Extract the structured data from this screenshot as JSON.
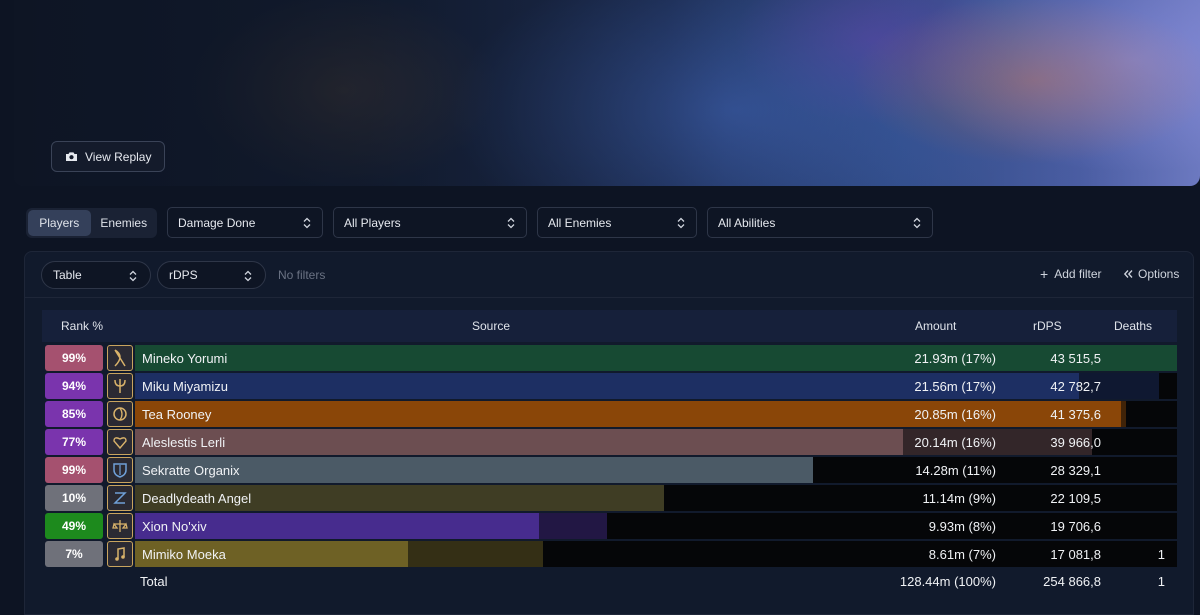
{
  "banner": {
    "replay_label": "View Replay"
  },
  "controls": {
    "segment": [
      "Players",
      "Enemies"
    ],
    "metric": "Damage Done",
    "players": "All Players",
    "enemies": "All Enemies",
    "abilities": "All Abilities"
  },
  "panel": {
    "view": "Table",
    "stat": "rDPS",
    "no_filters": "No filters",
    "add_filter": "Add filter",
    "options": "Options"
  },
  "table": {
    "headers": {
      "rank": "Rank %",
      "source": "Source",
      "amount": "Amount",
      "rdps": "rDPS",
      "deaths": "Deaths"
    },
    "rows": [
      {
        "rank": "99%",
        "rank_color": "#a5516f",
        "spec_icon": "bow-icon",
        "name": "Mineko Yorumi",
        "amount": "21.93m (17%)",
        "rdps": "43 515,5",
        "deaths": "",
        "bar_color": "#174a33",
        "amount_fraction": 1.0,
        "rdps_fraction": 1.0
      },
      {
        "rank": "94%",
        "rank_color": "#7a34ad",
        "spec_icon": "trident-icon",
        "name": "Miku Miyamizu",
        "amount": "21.56m (17%)",
        "rdps": "42 782,7",
        "deaths": "",
        "bar_color": "#1d2f63",
        "amount_fraction": 0.906,
        "rdps_fraction": 0.983
      },
      {
        "rank": "85%",
        "rank_color": "#7a34ad",
        "spec_icon": "spiral-icon",
        "name": "Tea Rooney",
        "amount": "20.85m (16%)",
        "rdps": "41 375,6",
        "deaths": "",
        "bar_color": "#8a4608",
        "amount_fraction": 0.946,
        "rdps_fraction": 0.951
      },
      {
        "rank": "77%",
        "rank_color": "#7a34ad",
        "spec_icon": "heart-icon",
        "name": "Aleslestis Lerli",
        "amount": "20.14m (16%)",
        "rdps": "39 966,0",
        "deaths": "",
        "bar_color": "#6c4e51",
        "amount_fraction": 0.737,
        "rdps_fraction": 0.918
      },
      {
        "rank": "99%",
        "rank_color": "#a5516f",
        "spec_icon": "shield-icon",
        "name": "Sekratte Organix",
        "amount": "14.28m (11%)",
        "rdps": "28 329,1",
        "deaths": "",
        "bar_color": "#4b5a66",
        "amount_fraction": 0.651,
        "rdps_fraction": 0.651
      },
      {
        "rank": "10%",
        "rank_color": "#6f717a",
        "spec_icon": "slash-icon",
        "name": "Deadlydeath Angel",
        "amount": "11.14m (9%)",
        "rdps": "22 109,5",
        "deaths": "",
        "bar_color": "#3f3d24",
        "amount_fraction": 0.508,
        "rdps_fraction": 0.508
      },
      {
        "rank": "49%",
        "rank_color": "#1d8a1d",
        "spec_icon": "scales-icon",
        "name": "Xion No'xiv",
        "amount": "9.93m (8%)",
        "rdps": "19 706,6",
        "deaths": "",
        "bar_color": "#472c8e",
        "amount_fraction": 0.388,
        "rdps_fraction": 0.453
      },
      {
        "rank": "7%",
        "rank_color": "#6f717a",
        "spec_icon": "music-note-icon",
        "name": "Mimiko Moeka",
        "amount": "8.61m (7%)",
        "rdps": "17 081,8",
        "deaths": "1",
        "bar_color": "#6e6125",
        "amount_fraction": 0.262,
        "rdps_fraction": 0.392
      }
    ],
    "total": {
      "label": "Total",
      "amount": "128.44m (100%)",
      "rdps": "254 866,8",
      "deaths": "1"
    }
  }
}
